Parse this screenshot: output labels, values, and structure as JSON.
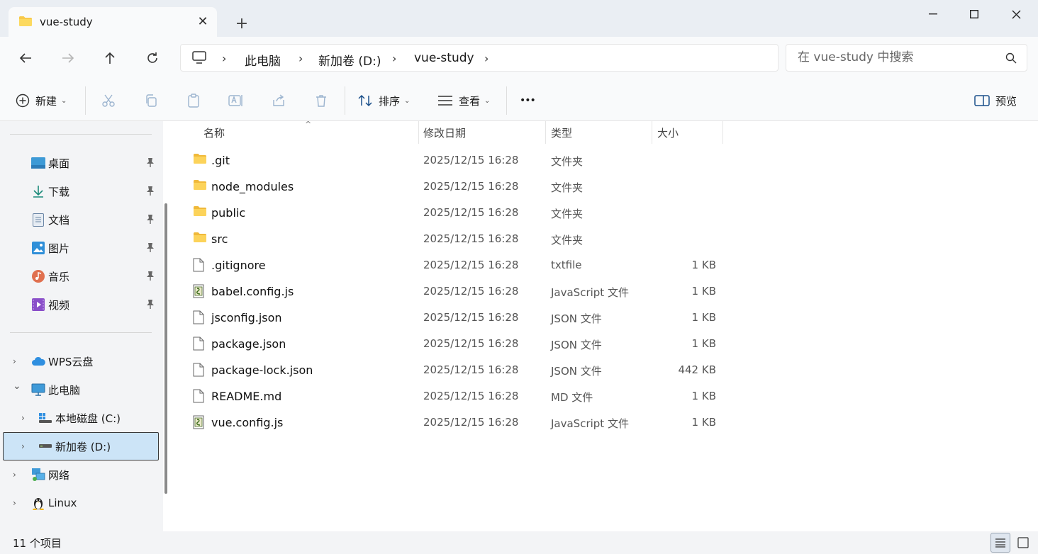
{
  "tab": {
    "title": "vue-study",
    "close_glyph": "✕",
    "new_tab_glyph": "+"
  },
  "window": {
    "minimize_icon": "minimize-icon",
    "maximize_icon": "maximize-icon",
    "close_icon": "close-icon"
  },
  "breadcrumb": {
    "items": [
      "此电脑",
      "新加卷 (D:)",
      "vue-study"
    ],
    "separator": "›"
  },
  "search": {
    "placeholder": "在 vue-study 中搜索"
  },
  "toolbar": {
    "new_label": "新建",
    "sort_label": "排序",
    "view_label": "查看",
    "more_glyph": "•••",
    "preview_label": "预览"
  },
  "sidebar": {
    "quick_access": [
      {
        "label": "桌面",
        "icon": "desktop-icon"
      },
      {
        "label": "下载",
        "icon": "download-icon"
      },
      {
        "label": "文档",
        "icon": "documents-icon"
      },
      {
        "label": "图片",
        "icon": "pictures-icon"
      },
      {
        "label": "音乐",
        "icon": "music-icon"
      },
      {
        "label": "视频",
        "icon": "videos-icon"
      }
    ],
    "tree": [
      {
        "label": "WPS云盘",
        "icon": "cloud-icon",
        "expander": "›"
      },
      {
        "label": "此电脑",
        "icon": "this-pc-icon",
        "expander": "⌄"
      },
      {
        "label": "本地磁盘 (C:)",
        "icon": "drive-icon",
        "expander": "›"
      },
      {
        "label": "新加卷 (D:)",
        "icon": "drive-icon",
        "expander": "›"
      },
      {
        "label": "网络",
        "icon": "network-icon",
        "expander": "›"
      },
      {
        "label": "Linux",
        "icon": "linux-icon",
        "expander": "›"
      }
    ]
  },
  "columns": {
    "name": "名称",
    "date": "修改日期",
    "type": "类型",
    "size": "大小",
    "sort_glyph": "^"
  },
  "files": [
    {
      "name": ".git",
      "date": "2025/12/15 16:28",
      "type": "文件夹",
      "size": "",
      "icon": "folder-icon"
    },
    {
      "name": "node_modules",
      "date": "2025/12/15 16:28",
      "type": "文件夹",
      "size": "",
      "icon": "folder-icon"
    },
    {
      "name": "public",
      "date": "2025/12/15 16:28",
      "type": "文件夹",
      "size": "",
      "icon": "folder-icon"
    },
    {
      "name": "src",
      "date": "2025/12/15 16:28",
      "type": "文件夹",
      "size": "",
      "icon": "folder-icon"
    },
    {
      "name": ".gitignore",
      "date": "2025/12/15 16:28",
      "type": "txtfile",
      "size": "1 KB",
      "icon": "file-icon"
    },
    {
      "name": "babel.config.js",
      "date": "2025/12/15 16:28",
      "type": "JavaScript 文件",
      "size": "1 KB",
      "icon": "js-file-icon"
    },
    {
      "name": "jsconfig.json",
      "date": "2025/12/15 16:28",
      "type": "JSON 文件",
      "size": "1 KB",
      "icon": "file-icon"
    },
    {
      "name": "package.json",
      "date": "2025/12/15 16:28",
      "type": "JSON 文件",
      "size": "1 KB",
      "icon": "file-icon"
    },
    {
      "name": "package-lock.json",
      "date": "2025/12/15 16:28",
      "type": "JSON 文件",
      "size": "442 KB",
      "icon": "file-icon"
    },
    {
      "name": "README.md",
      "date": "2025/12/15 16:28",
      "type": "MD 文件",
      "size": "1 KB",
      "icon": "file-icon"
    },
    {
      "name": "vue.config.js",
      "date": "2025/12/15 16:28",
      "type": "JavaScript 文件",
      "size": "1 KB",
      "icon": "js-file-icon"
    }
  ],
  "status": {
    "item_count": "11 个项目"
  },
  "colors": {
    "accent": "#0067c0",
    "folder": "#f8c94a",
    "selected_bg": "#cce4f7"
  }
}
